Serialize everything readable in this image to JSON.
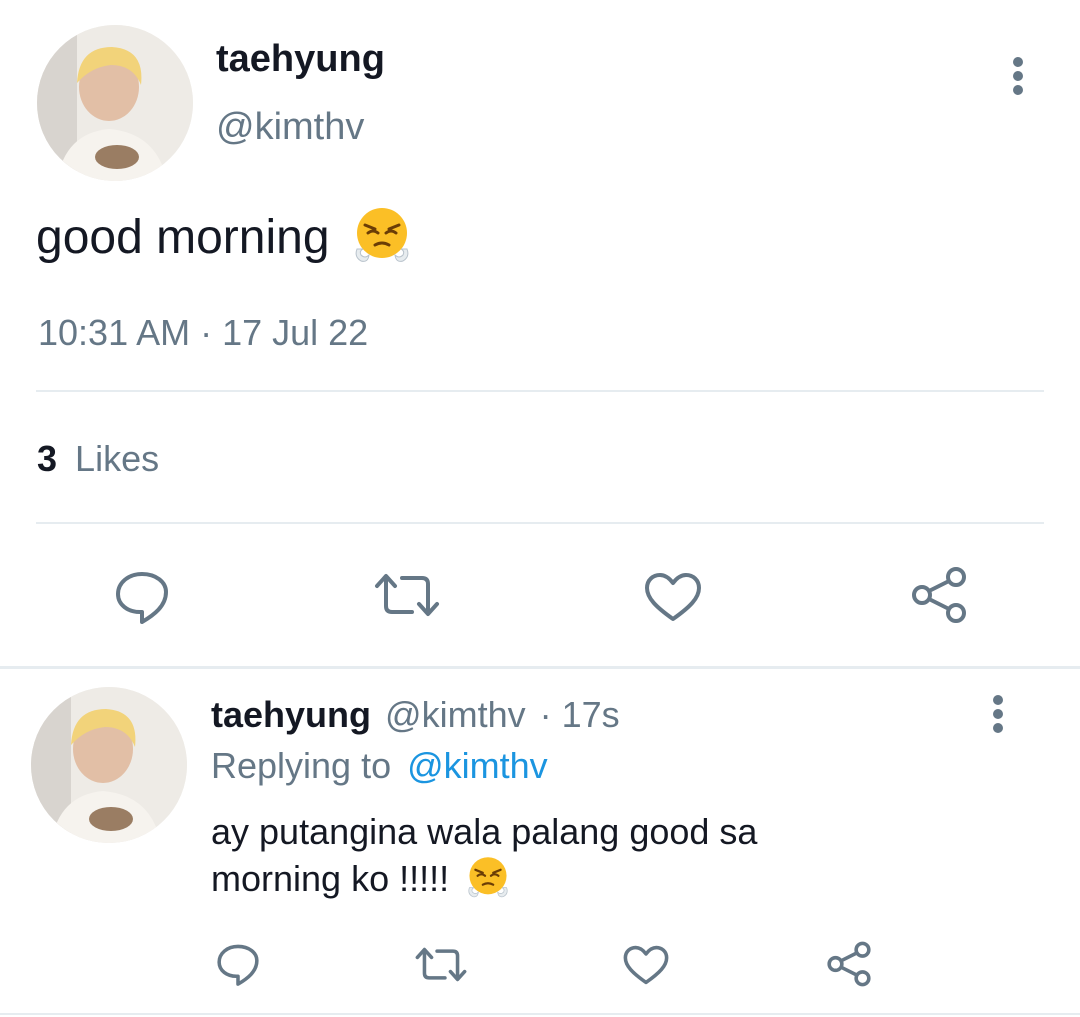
{
  "tweet": {
    "display_name": "taehyung",
    "handle": "@kimthv",
    "text": "good morning",
    "emoji": "face-with-steam-from-nose",
    "timestamp": "10:31 AM · 17 Jul 22",
    "likes_count": "3",
    "likes_label": "Likes"
  },
  "reply": {
    "display_name": "taehyung",
    "handle": "@kimthv",
    "time": "· 17s",
    "replying_prefix": "Replying to",
    "replying_handle": "@kimthv",
    "text_line1": "ay putangina wala palang good sa",
    "text_line2": "morning ko !!!!!",
    "emoji": "face-with-steam-from-nose"
  },
  "actions": [
    "reply-icon",
    "retweet-icon",
    "like-icon",
    "share-icon"
  ],
  "colors": {
    "text": "#141823",
    "muted": "#657786",
    "link": "#1b95e0",
    "divider": "#e6ecf0"
  }
}
